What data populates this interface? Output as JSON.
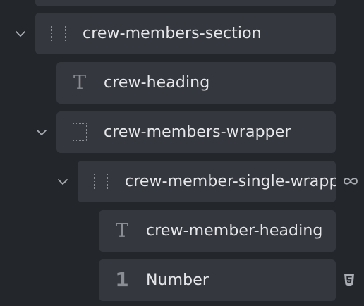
{
  "tree": {
    "items": [
      {
        "label": "crew-members-section",
        "icon": "div-block-icon"
      },
      {
        "label": "crew-heading",
        "icon": "text-heading-icon"
      },
      {
        "label": "crew-members-wrapper",
        "icon": "div-block-icon"
      },
      {
        "label": "crew-member-single-wrapper",
        "icon": "div-block-icon",
        "badge": "link-icon"
      },
      {
        "label": "crew-member-heading",
        "icon": "text-heading-icon"
      },
      {
        "label": "Number",
        "icon": "number-icon",
        "icon_glyph": "1",
        "badge": "css3-icon"
      }
    ]
  },
  "colors": {
    "background": "#23262b",
    "item_background": "#34373d",
    "text": "#e6e7ea",
    "icon": "#8a8d93"
  }
}
